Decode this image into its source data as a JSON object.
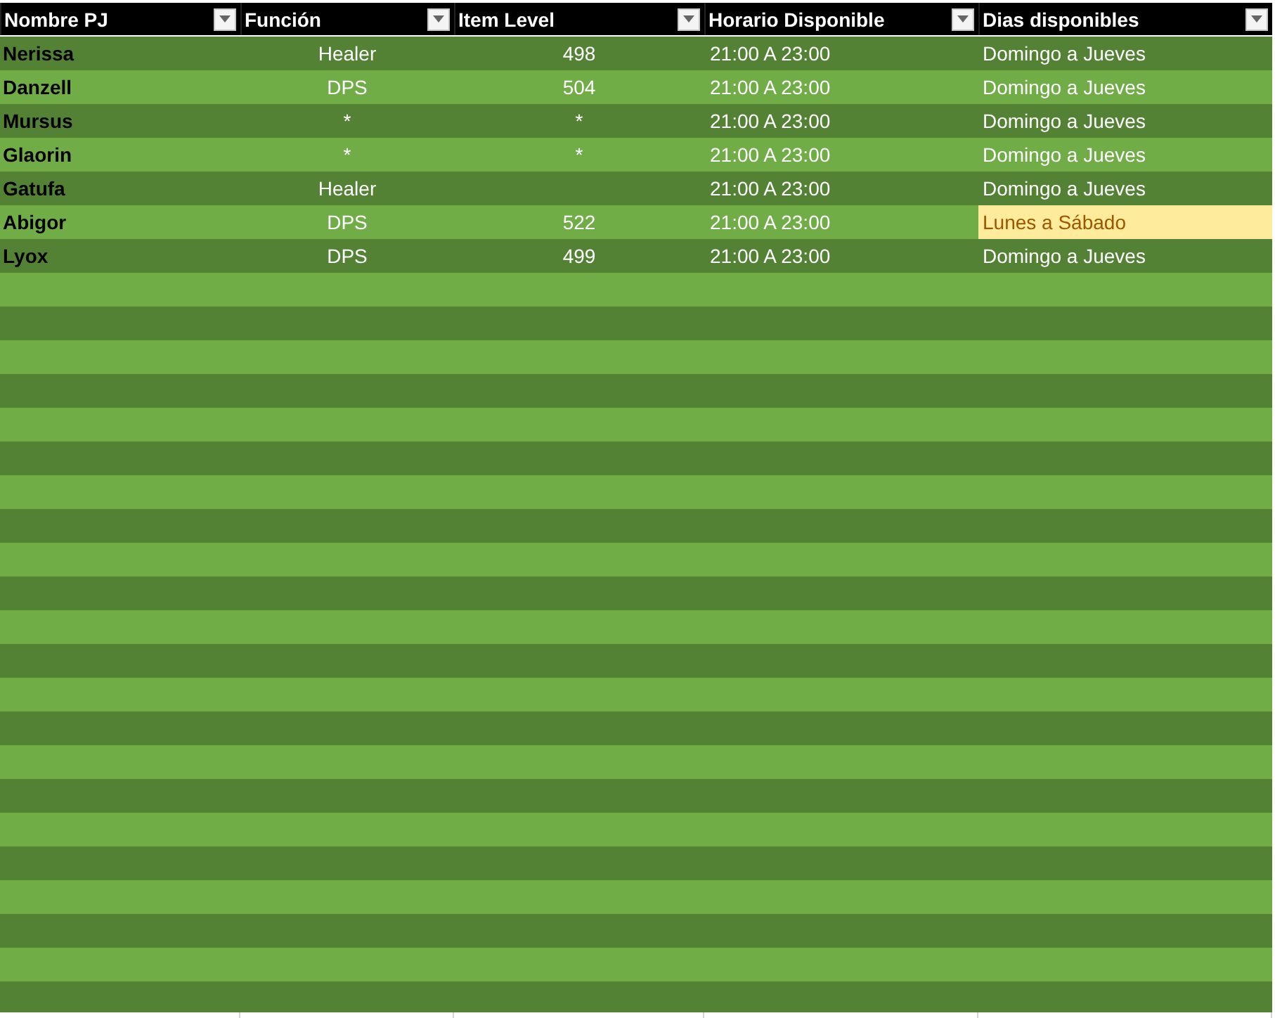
{
  "table": {
    "columns": [
      "Nombre PJ",
      "Función",
      "Item Level",
      "Horario Disponible",
      "Dias disponibles"
    ],
    "rows": [
      {
        "name": "Nerissa",
        "role": "Healer",
        "item_level": "498",
        "hours": "21:00 A 23:00",
        "days": "Domingo a Jueves",
        "days_highlighted": false
      },
      {
        "name": "Danzell",
        "role": "DPS",
        "item_level": "504",
        "hours": "21:00 A 23:00",
        "days": "Domingo a Jueves",
        "days_highlighted": false
      },
      {
        "name": "Mursus",
        "role": "*",
        "item_level": "*",
        "hours": "21:00 A 23:00",
        "days": "Domingo a Jueves",
        "days_highlighted": false
      },
      {
        "name": "Glaorin",
        "role": "*",
        "item_level": "*",
        "hours": "21:00 A 23:00",
        "days": "Domingo a Jueves",
        "days_highlighted": false
      },
      {
        "name": "Gatufa",
        "role": "Healer",
        "hours": "21:00 A 23:00",
        "days": "Domingo a Jueves",
        "days_highlighted": false
      },
      {
        "name": "Abigor",
        "role": "DPS",
        "item_level": "522",
        "hours": "21:00 A 23:00",
        "days": "Lunes a Sábado",
        "days_highlighted": true
      },
      {
        "name": "Lyox",
        "role": "DPS",
        "item_level": "499",
        "hours": "21:00 A 23:00",
        "days": "Domingo a Jueves",
        "days_highlighted": false
      }
    ]
  }
}
